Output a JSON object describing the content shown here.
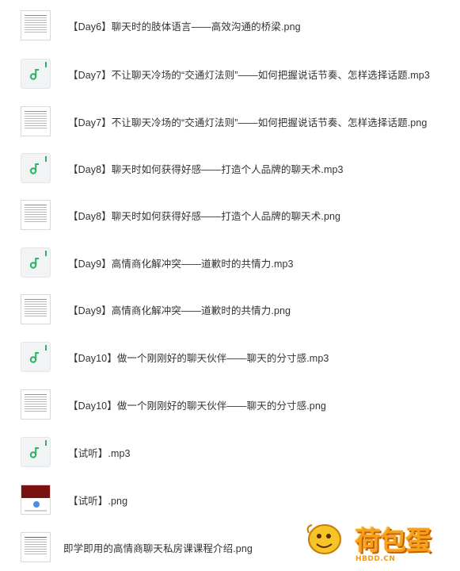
{
  "files": [
    {
      "type": "image",
      "name": "【Day6】聊天时的肢体语言——高效沟通的桥梁.png"
    },
    {
      "type": "audio",
      "name": "【Day7】不让聊天冷场的“交通灯法则”——如何把握说话节奏、怎样选择话题.mp3"
    },
    {
      "type": "image",
      "name": "【Day7】不让聊天冷场的“交通灯法则”——如何把握说话节奏、怎样选择话题.png"
    },
    {
      "type": "audio",
      "name": "【Day8】聊天时如何获得好感——打造个人品牌的聊天术.mp3"
    },
    {
      "type": "image",
      "name": "【Day8】聊天时如何获得好感——打造个人品牌的聊天术.png"
    },
    {
      "type": "audio",
      "name": "【Day9】高情商化解冲突——道歉时的共情力.mp3"
    },
    {
      "type": "image",
      "name": "【Day9】高情商化解冲突——道歉时的共情力.png"
    },
    {
      "type": "audio",
      "name": "【Day10】做一个刚刚好的聊天伙伴——聊天的分寸感.mp3"
    },
    {
      "type": "image",
      "name": "【Day10】做一个刚刚好的聊天伙伴——聊天的分寸感.png"
    },
    {
      "type": "audio",
      "name": "【试听】.mp3"
    },
    {
      "type": "image-screenshot",
      "name": "【试听】.png"
    },
    {
      "type": "image",
      "name": "即学即用的高情商聊天私房课课程介绍.png"
    }
  ],
  "watermark": {
    "logo_text": "荷包蛋",
    "url_text": "HBDD.CN"
  },
  "colors": {
    "audio_accent": "#2db35f",
    "watermark": "#f5a21a"
  }
}
